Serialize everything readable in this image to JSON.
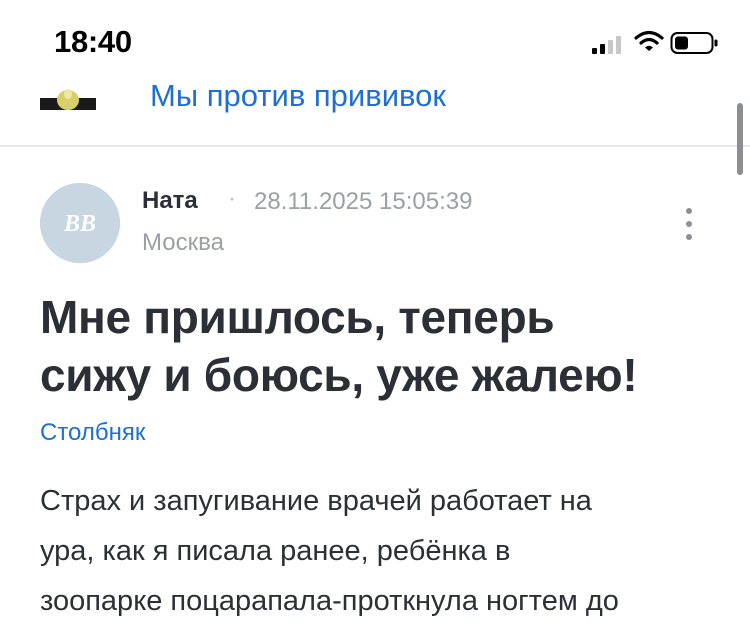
{
  "status_bar": {
    "time": "18:40"
  },
  "header": {
    "group_title": "Мы против прививок"
  },
  "post": {
    "author": "Ната",
    "separator": "·",
    "datetime": "28.11.2025 15:05:39",
    "city": "Москва",
    "avatar_initials": "ВВ",
    "title_lines": [
      "Мне пришлось, теперь",
      "сижу и боюсь, уже жалею!"
    ],
    "tag": "Столбняк",
    "body_lines": [
      "Страх и запугивание врачей работает на",
      "ура, как я писала ранее, ребёнка в",
      "зоопарке поцарапала-проткнула ногтем до"
    ]
  },
  "colors": {
    "link": "#1f6fd1",
    "avatar_bg": "#c8d6e2",
    "text": "#2b2f36",
    "muted": "#9aa0a6"
  }
}
